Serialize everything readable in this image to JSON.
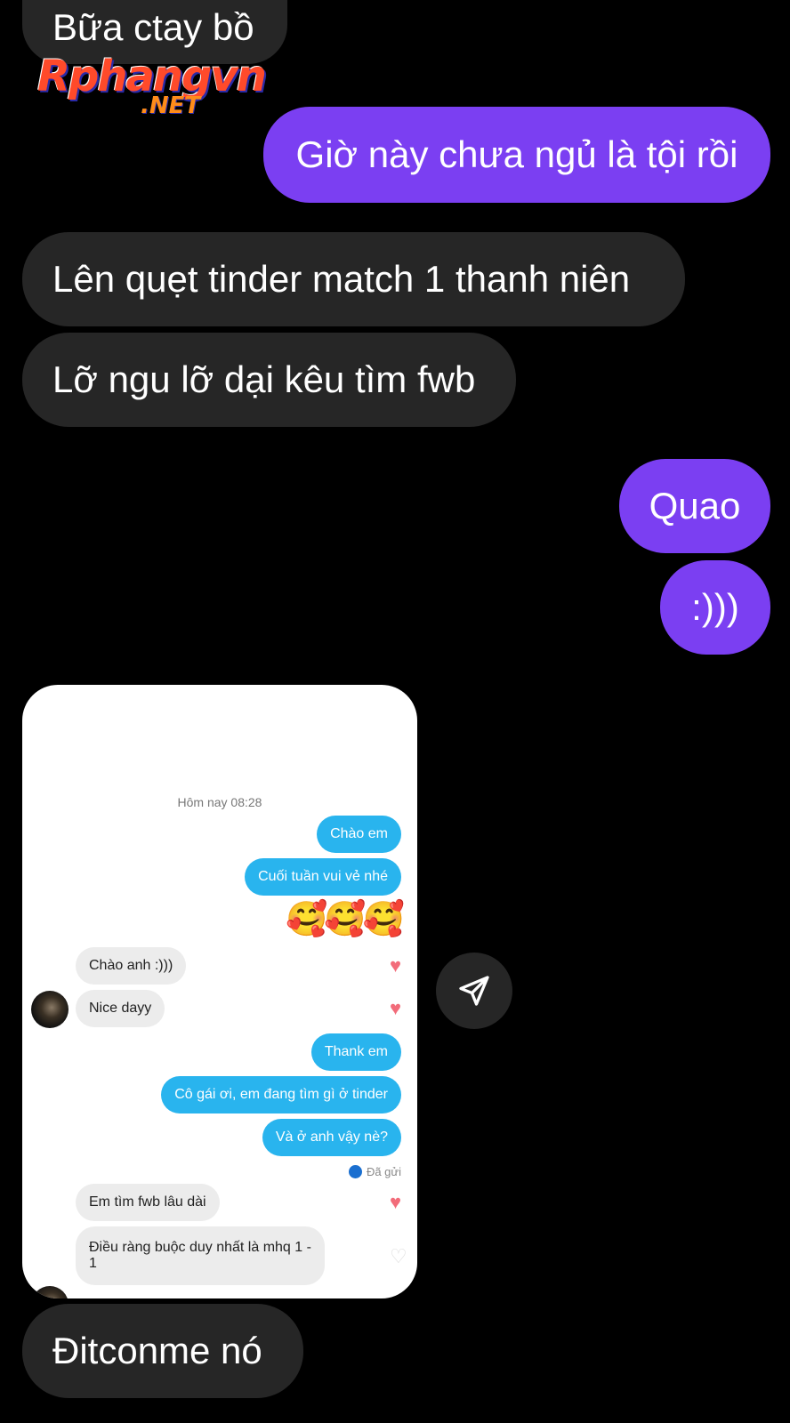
{
  "watermark": {
    "main": "Rphangvn",
    "sub": ".NET"
  },
  "messages": {
    "m1": "Bữa ctay bồ",
    "m2": "Giờ này chưa ngủ là tội rồi",
    "m3": "Lên quẹt tinder match 1 thanh niên",
    "m4": "Lỡ ngu lỡ dại kêu tìm fwb",
    "m5": "Quao",
    "m6": ":)))",
    "m7": "Đitconme nó"
  },
  "screenshot": {
    "timestamp": "Hôm nay 08:28",
    "b1": "Chào em",
    "b2": "Cuối tuần vui vẻ nhé",
    "emojis": "🥰🥰🥰",
    "b3": "Chào anh :)))",
    "b4": "Nice dayy",
    "b5": "Thank em",
    "b6": "Cô gái ơi, em đang tìm gì ở tinder",
    "b7": "Và ở anh vậy nè?",
    "seen": "Đã gửi",
    "b8": "Em tìm fwb lâu dài",
    "b9_line1": "Điều ràng buộc duy nhất là mhq 1 -",
    "b9_line2": "1"
  },
  "colors": {
    "sent": "#7b3ff2",
    "received": "#262626",
    "tinder_out": "#29b4ee"
  },
  "icons": {
    "send": "paper-plane-icon",
    "heart": "heart-icon"
  }
}
